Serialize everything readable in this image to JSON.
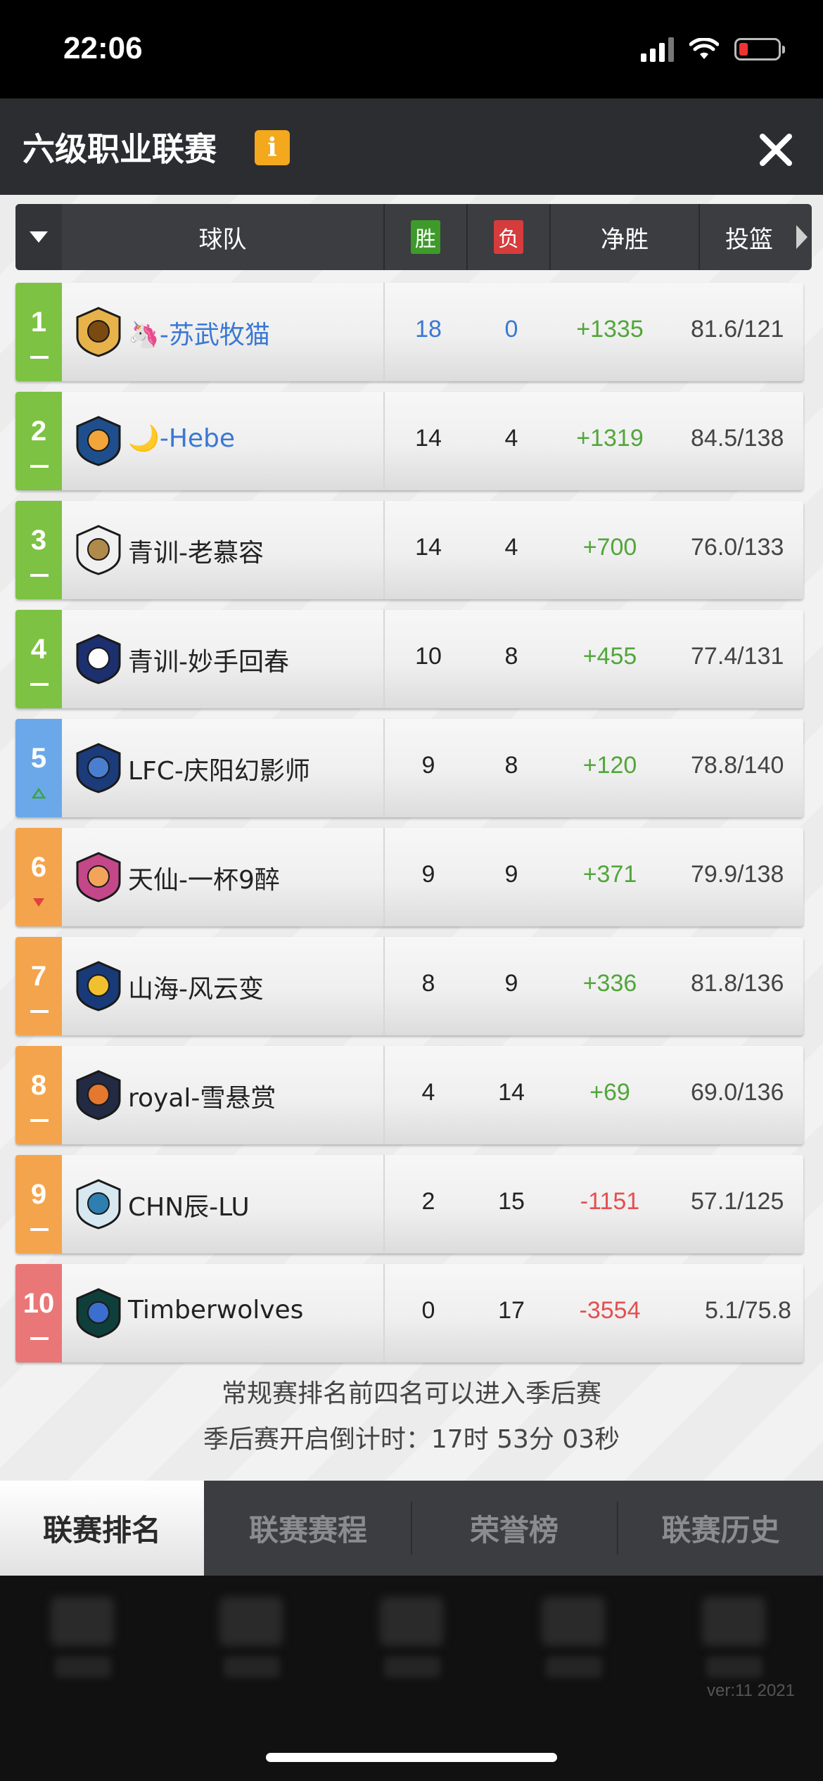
{
  "status": {
    "time": "22:06"
  },
  "header": {
    "title": "六级职业联赛",
    "info_icon": "i"
  },
  "table": {
    "col_team": "球队",
    "col_win": "胜",
    "col_loss": "负",
    "col_net": "净胜",
    "col_shooting": "投篮"
  },
  "colors": {
    "green": "#7dc242",
    "blue": "#6ba8ea",
    "orange": "#f4a44c",
    "red": "#ea7777"
  },
  "rows": [
    {
      "rank": "1",
      "name": "🦄-苏武牧猫",
      "win": "18",
      "loss": "0",
      "net": "+1335",
      "shooting": "81.6/121",
      "rank_color": "green",
      "trend": "flat"
    },
    {
      "rank": "2",
      "name": "🌙-Hebe",
      "win": "14",
      "loss": "4",
      "net": "+1319",
      "shooting": "84.5/138",
      "rank_color": "green",
      "trend": "flat"
    },
    {
      "rank": "3",
      "name": "青训-老慕容",
      "win": "14",
      "loss": "4",
      "net": "+700",
      "shooting": "76.0/133",
      "rank_color": "green",
      "trend": "flat"
    },
    {
      "rank": "4",
      "name": "青训-妙手回春",
      "win": "10",
      "loss": "8",
      "net": "+455",
      "shooting": "77.4/131",
      "rank_color": "green",
      "trend": "flat"
    },
    {
      "rank": "5",
      "name": "LFC-庆阳幻影师",
      "win": "9",
      "loss": "8",
      "net": "+120",
      "shooting": "78.8/140",
      "rank_color": "blue",
      "trend": "up"
    },
    {
      "rank": "6",
      "name": "天仙-一杯9醉",
      "win": "9",
      "loss": "9",
      "net": "+371",
      "shooting": "79.9/138",
      "rank_color": "orange",
      "trend": "down"
    },
    {
      "rank": "7",
      "name": "山海-风云变",
      "win": "8",
      "loss": "9",
      "net": "+336",
      "shooting": "81.8/136",
      "rank_color": "orange",
      "trend": "flat"
    },
    {
      "rank": "8",
      "name": "royal-雪悬赏",
      "win": "4",
      "loss": "14",
      "net": "+69",
      "shooting": "69.0/136",
      "rank_color": "orange",
      "trend": "flat"
    },
    {
      "rank": "9",
      "name": "CHN辰-LU",
      "win": "2",
      "loss": "15",
      "net": "-1151",
      "shooting": "57.1/125",
      "rank_color": "orange",
      "trend": "flat"
    },
    {
      "rank": "10",
      "name": "Timberwolves",
      "win": "0",
      "loss": "17",
      "net": "-3554",
      "shooting": "5.1/75.8",
      "rank_color": "red",
      "trend": "flat"
    }
  ],
  "notes": {
    "line1": "常规赛排名前四名可以进入季后赛",
    "line2": "季后赛开启倒计时：17时 53分 03秒"
  },
  "tabs": [
    "联赛排名",
    "联赛赛程",
    "荣誉榜",
    "联赛历史"
  ],
  "footer": {
    "version": "ver:11  2021"
  }
}
